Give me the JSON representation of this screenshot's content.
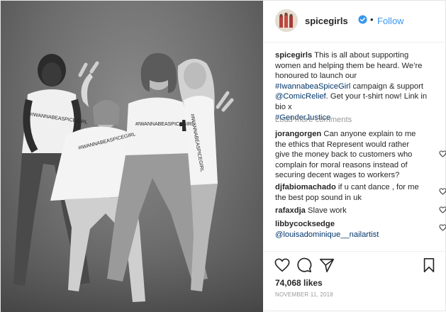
{
  "header": {
    "username": "spicegirls",
    "separator": "•",
    "follow_label": "Follow"
  },
  "photo": {
    "shirt_text": "#IWANNABEASPICEGIRL"
  },
  "caption": {
    "username": "spicegirls",
    "text_before_tag1": " This is all about supporting women and helping them be heard. We’re honoured to launch our ",
    "tag1": "#IwannabeaSpiceGirl",
    "text_between": " campaign & support ",
    "mention": "@ComicRelief",
    "text_after": ". Get your t-shirt now! Link in bio x",
    "tag2": "#GenderJustice"
  },
  "load_more_label": "Load more comments",
  "comments": [
    {
      "username": "jorangorgen",
      "text": " Can anyone explain to me the ethics that Represent would rather give the money back to customers who complain for moral reasons instead of securing decent wages to workers?"
    },
    {
      "username": "djfabiomachado",
      "text": " if u cant dance , for me the best pop sound in uk"
    },
    {
      "username": "rafaxdja",
      "text": " Slave work"
    },
    {
      "username": "libbycocksedge",
      "mention": "@louisadominique__nailartist"
    }
  ],
  "likes": "74,068 likes",
  "date": "NOVEMBER 11, 2018",
  "colors": {
    "link_blue": "#3897f0",
    "tag_navy": "#003569",
    "muted_gray": "#999999",
    "text": "#262626"
  },
  "icons": [
    "verified-badge-icon",
    "heart-icon",
    "comment-icon",
    "share-icon",
    "bookmark-icon"
  ]
}
